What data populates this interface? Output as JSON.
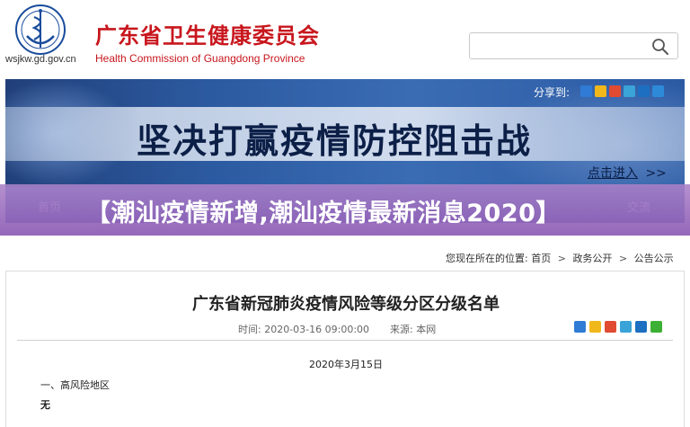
{
  "header": {
    "domain": "wsjkw.gd.gov.cn",
    "title_cn": "广东省卫生健康委员会",
    "title_en": "Health Commission of Guangdong Province",
    "search_placeholder": ""
  },
  "banner": {
    "share_label": "分享到:",
    "slogan": "坚决打赢疫情防控阻击战",
    "click_enter": "点击进入",
    "click_enter_arrow": ">>"
  },
  "nav": {
    "items": [
      {
        "label": "首页"
      },
      {
        "label": "交流"
      }
    ]
  },
  "overlay": {
    "text": "【潮汕疫情新增,潮汕疫情最新消息2020】"
  },
  "breadcrumb": {
    "prefix": "您现在所在的位置:",
    "home": "首页",
    "level1": "政务公开",
    "level2": "公告公示",
    "sep": ">"
  },
  "article": {
    "title": "广东省新冠肺炎疫情风险等级分区分级名单",
    "time_label": "时间:",
    "time_value": "2020-03-16 09:00:00",
    "source_label": "来源:",
    "source_value": "本网",
    "date_line": "2020年3月15日",
    "section1": "一、高风险地区",
    "section1_value": "无"
  },
  "colors": {
    "brand_red": "#c8161d",
    "banner_blue": "#2c5aa0",
    "nav_blue": "#3b64b0",
    "overlay_purple": "#9a64c0"
  },
  "icons": {
    "share": [
      "plus-icon",
      "qzone-icon",
      "weibo-icon",
      "tencent-weibo-icon",
      "renren-icon",
      "more-icon"
    ],
    "meta_share": [
      "plus-icon",
      "qzone-icon",
      "weibo-icon",
      "tencent-weibo-icon",
      "renren-icon",
      "wechat-icon"
    ]
  }
}
